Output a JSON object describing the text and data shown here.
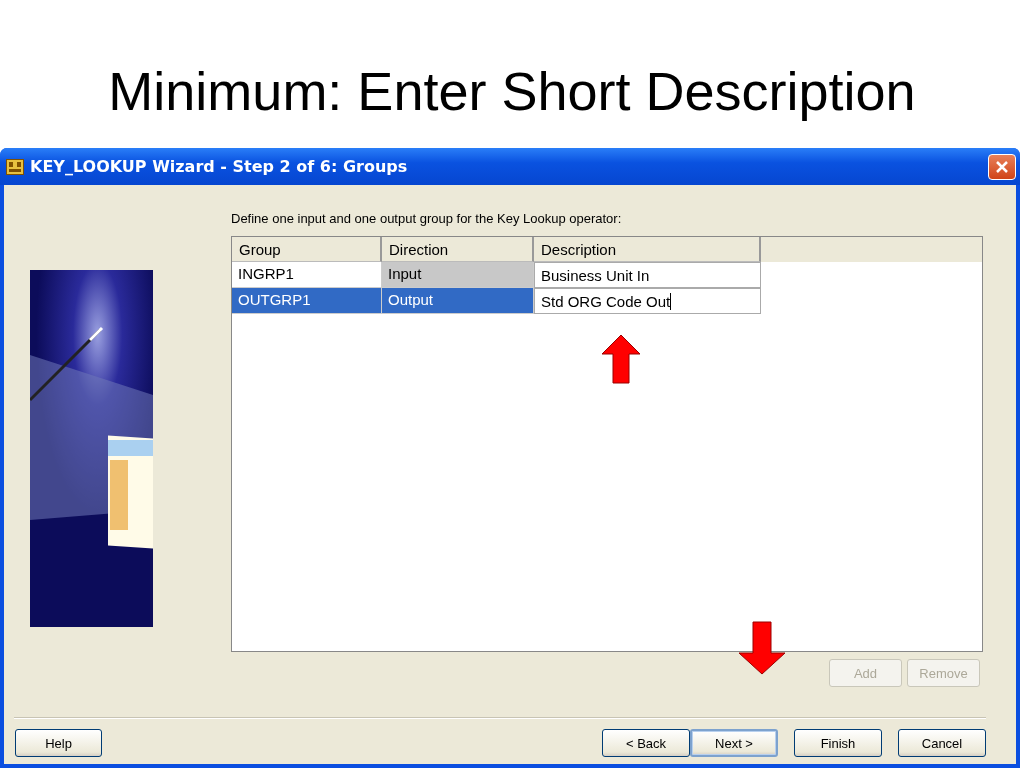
{
  "slide_title": "Minimum: Enter Short Description",
  "window": {
    "title": "KEY_LOOKUP Wizard - Step 2 of 6: Groups"
  },
  "instruction": "Define one input and one output group for the Key Lookup operator:",
  "table": {
    "columns": [
      "Group",
      "Direction",
      "Description"
    ],
    "rows": [
      {
        "group": "INGRP1",
        "direction": "Input",
        "description": "Business Unit In",
        "selected": false,
        "editing": false
      },
      {
        "group": "OUTGRP1",
        "direction": "Output",
        "description": "Std ORG Code Out",
        "selected": true,
        "editing": true
      }
    ]
  },
  "table_buttons": [
    {
      "label": "Add",
      "disabled": true
    },
    {
      "label": "Remove",
      "disabled": true
    }
  ],
  "help_button": {
    "label": "Help"
  },
  "nav_buttons": [
    {
      "label": "< Back",
      "default": false
    },
    {
      "label": "Next >",
      "default": true
    },
    {
      "label": "Finish",
      "default": false
    },
    {
      "label": "Cancel",
      "default": false
    }
  ]
}
